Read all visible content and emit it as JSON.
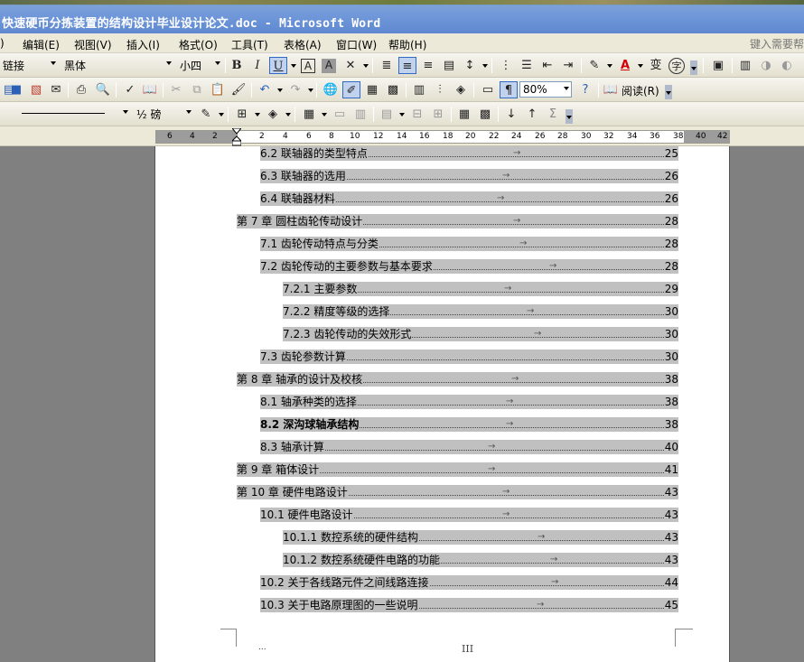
{
  "window": {
    "title": "快速硬币分拣装置的结构设计毕业设计论文.doc - Microsoft Word"
  },
  "menu": {
    "items": [
      {
        "label": ")",
        "name": "menu-file"
      },
      {
        "label": "编辑(E)",
        "name": "menu-edit"
      },
      {
        "label": "视图(V)",
        "name": "menu-view"
      },
      {
        "label": "插入(I)",
        "name": "menu-insert"
      },
      {
        "label": "格式(O)",
        "name": "menu-format"
      },
      {
        "label": "工具(T)",
        "name": "menu-tools"
      },
      {
        "label": "表格(A)",
        "name": "menu-table"
      },
      {
        "label": "窗口(W)",
        "name": "menu-window"
      },
      {
        "label": "帮助(H)",
        "name": "menu-help"
      }
    ],
    "help_placeholder": "键入需要帮"
  },
  "formatting": {
    "style": "链接",
    "font": "黑体",
    "size": "小四",
    "color_accent": "#d4000a"
  },
  "standard": {
    "zoom": "80%",
    "read_label": "阅读(R)"
  },
  "drawing": {
    "line_weight": "½ 磅"
  },
  "ruler": {
    "labels": [
      "6",
      "4",
      "2",
      "2",
      "4",
      "6",
      "8",
      "10",
      "12",
      "14",
      "16",
      "18",
      "20",
      "22",
      "24",
      "26",
      "28",
      "30",
      "32",
      "34",
      "36",
      "38",
      "40",
      "42"
    ]
  },
  "toc": [
    {
      "text": "6.2 联轴器的类型特点",
      "page": "25"
    },
    {
      "text": "6.3 联轴器的选用",
      "page": "26"
    },
    {
      "text": "6.4 联轴器材料",
      "page": "26"
    },
    {
      "text": "第 7 章 圆柱齿轮传动设计",
      "page": "28"
    },
    {
      "text": "7.1 齿轮传动特点与分类",
      "page": "28"
    },
    {
      "text": "7.2 齿轮传动的主要参数与基本要求",
      "page": "28"
    },
    {
      "text": "7.2.1 主要参数",
      "page": "29"
    },
    {
      "text": "7.2.2 精度等级的选择",
      "page": "30"
    },
    {
      "text": "7.2.3 齿轮传动的失效形式",
      "page": "30"
    },
    {
      "text": "7.3 齿轮参数计算",
      "page": "30"
    },
    {
      "text": "第 8 章 轴承的设计及校核",
      "page": "38"
    },
    {
      "text": "8.1 轴承种类的选择",
      "page": "38"
    },
    {
      "text": "8.2 深沟球轴承结构",
      "page": "38"
    },
    {
      "text": "8.3 轴承计算",
      "page": "40"
    },
    {
      "text": "第 9 章 箱体设计",
      "page": "41"
    },
    {
      "text": "第 10 章 硬件电路设计",
      "page": "43"
    },
    {
      "text": "10.1 硬件电路设计",
      "page": "43"
    },
    {
      "text": "10.1.1 数控系统的硬件结构",
      "page": "43"
    },
    {
      "text": "10.1.2 数控系统硬件电路的功能",
      "page": "43"
    },
    {
      "text": "10.2 关于各线路元件之间线路连接",
      "page": "44"
    },
    {
      "text": "10.3 关于电路原理图的一些说明",
      "page": "45"
    }
  ],
  "footer": {
    "page_number": "III",
    "mark": "..."
  },
  "colors": {
    "toc_highlight": "#c0c0c0",
    "title_bar": "#6d95d8"
  }
}
